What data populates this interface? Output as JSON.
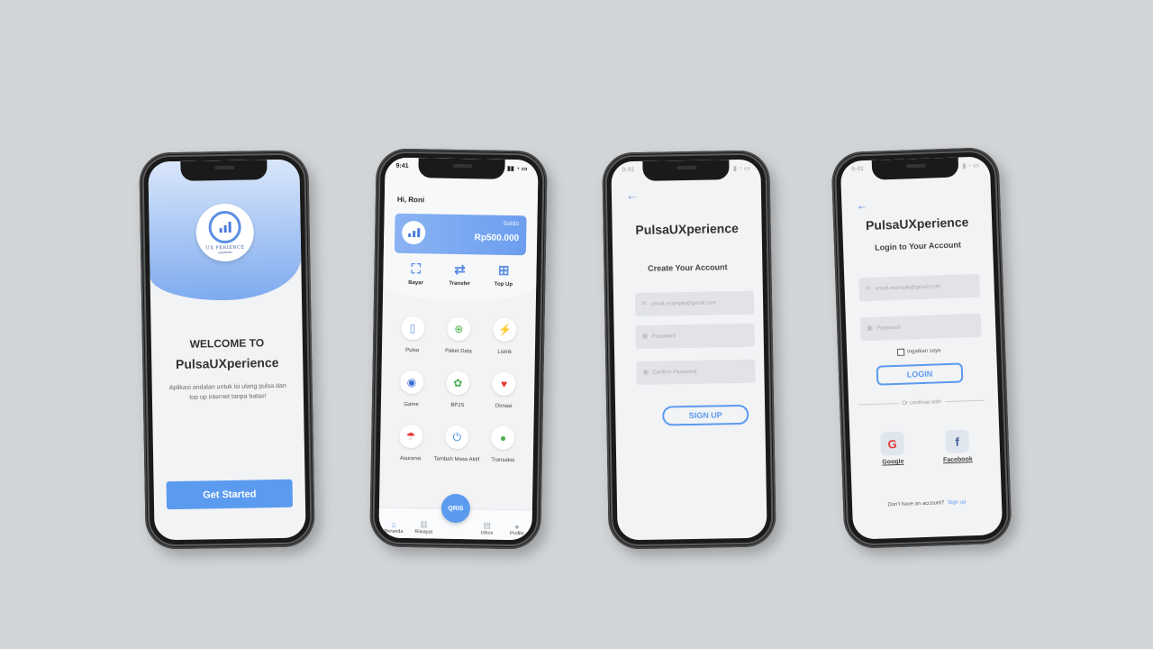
{
  "colors": {
    "background": "#d2d5d8",
    "accent": "#5b9bef",
    "phone_frame": "#1a1a1a",
    "screen": "#f2f3f5"
  },
  "brand": {
    "logo_text": "UX PERIENCE",
    "logo_sub": "payment"
  },
  "welcome_screen": {
    "line1": "WELCOME TO",
    "line2": "PulsaUXperience",
    "description": "Aplikasi andalan untuk isi ulang pulsa dan top up internet tanpa batas!",
    "cta_label": "Get Started"
  },
  "home_screen": {
    "time": "9:41",
    "greeting": "Hi, Roni",
    "saldo_label": "Saldo",
    "saldo_value": "Rp500.000",
    "quick_actions": [
      {
        "label": "Bayar",
        "icon": "scan-icon"
      },
      {
        "label": "Transfer",
        "icon": "transfer-icon"
      },
      {
        "label": "Top Up",
        "icon": "wallet-icon"
      }
    ],
    "services": [
      {
        "label": "Pulsa",
        "icon": "phone-icon"
      },
      {
        "label": "Paket Data",
        "icon": "globe-icon"
      },
      {
        "label": "Listrik",
        "icon": "lightning-icon"
      },
      {
        "label": "Game",
        "icon": "gamepad-icon"
      },
      {
        "label": "BPJS",
        "icon": "health-icon"
      },
      {
        "label": "Donasi",
        "icon": "heart-icon"
      },
      {
        "label": "Asuransi",
        "icon": "umbrella-icon"
      },
      {
        "label": "Tambah Masa Aktif",
        "icon": "power-icon"
      },
      {
        "label": "Transaksi",
        "icon": "people-icon"
      }
    ],
    "nav": [
      {
        "label": "Beranda",
        "icon": "home-icon"
      },
      {
        "label": "Riwayat",
        "icon": "chart-icon"
      },
      {
        "label": "Inbox",
        "icon": "inbox-icon"
      },
      {
        "label": "Profile",
        "icon": "user-icon"
      }
    ],
    "qris_label": "QRIS"
  },
  "signup_screen": {
    "time": "9:41",
    "title": "PulsaUXperience",
    "subtitle": "Create Your Account",
    "email_placeholder": "email.example@gmail.com",
    "password_placeholder": "Password",
    "confirm_placeholder": "Confirm Password",
    "button_label": "SIGN UP"
  },
  "login_screen": {
    "time": "9:41",
    "title": "PulsaUXperience",
    "subtitle": "Login to Your Account",
    "email_placeholder": "email.example@gmail.com",
    "password_placeholder": "Password",
    "remember_label": "Ingatkan saya",
    "button_label": "LOGIN",
    "divider_label": "Or continue with",
    "socials": [
      {
        "label": "Google"
      },
      {
        "label": "Facebook"
      }
    ],
    "no_account": "Don't have an account?",
    "signup_link": "Sign up"
  }
}
